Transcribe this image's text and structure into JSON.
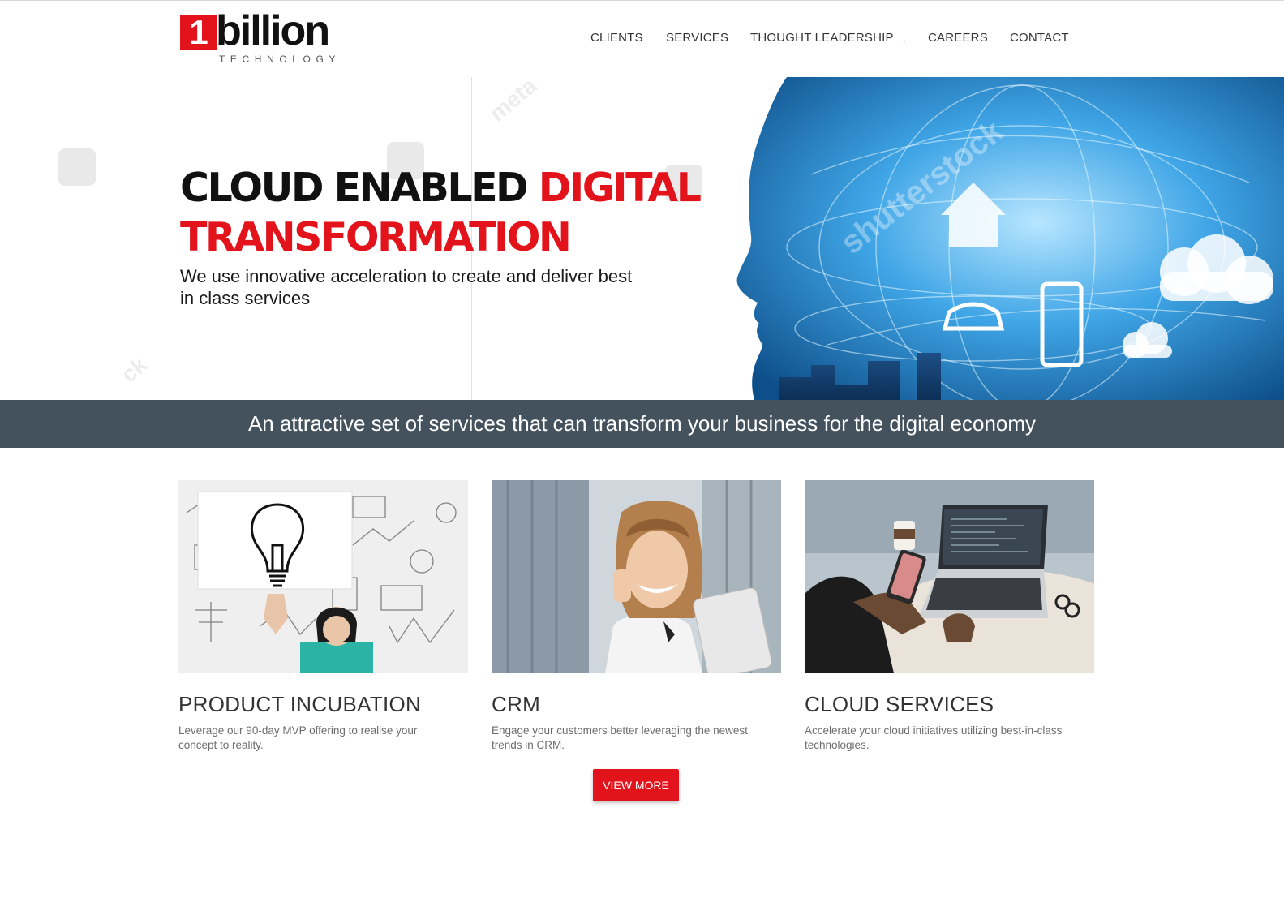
{
  "brand": {
    "logo_number": "1",
    "logo_word": "billion",
    "logo_sub": "TECHNOLOGY",
    "red": "#e3131b"
  },
  "nav": {
    "items": [
      "CLIENTS",
      "SERVICES",
      "THOUGHT LEADERSHIP",
      "CAREERS",
      "CONTACT"
    ],
    "caret": "⌄"
  },
  "hero": {
    "title_black": "CLOUD ENABLED ",
    "title_red_1": "DIGITAL",
    "title_red_2": "TRANSFORMATION",
    "subtitle": "We use innovative acceleration to create and deliver best in class services",
    "image_watermark": "shutterstock"
  },
  "banner": {
    "text": "An attractive set of services that can transform your business for the digital economy",
    "color": "#44525e"
  },
  "cards": [
    {
      "title": "PRODUCT INCUBATION",
      "desc": "Leverage our 90-day MVP offering to realise your concept to reality."
    },
    {
      "title": "CRM",
      "desc": "Engage your customers better leveraging the newest trends in CRM."
    },
    {
      "title": "CLOUD SERVICES",
      "desc": "Accelerate your cloud initiatives utilizing best-in-class technologies."
    }
  ],
  "cta": {
    "label": "VIEW MORE"
  }
}
